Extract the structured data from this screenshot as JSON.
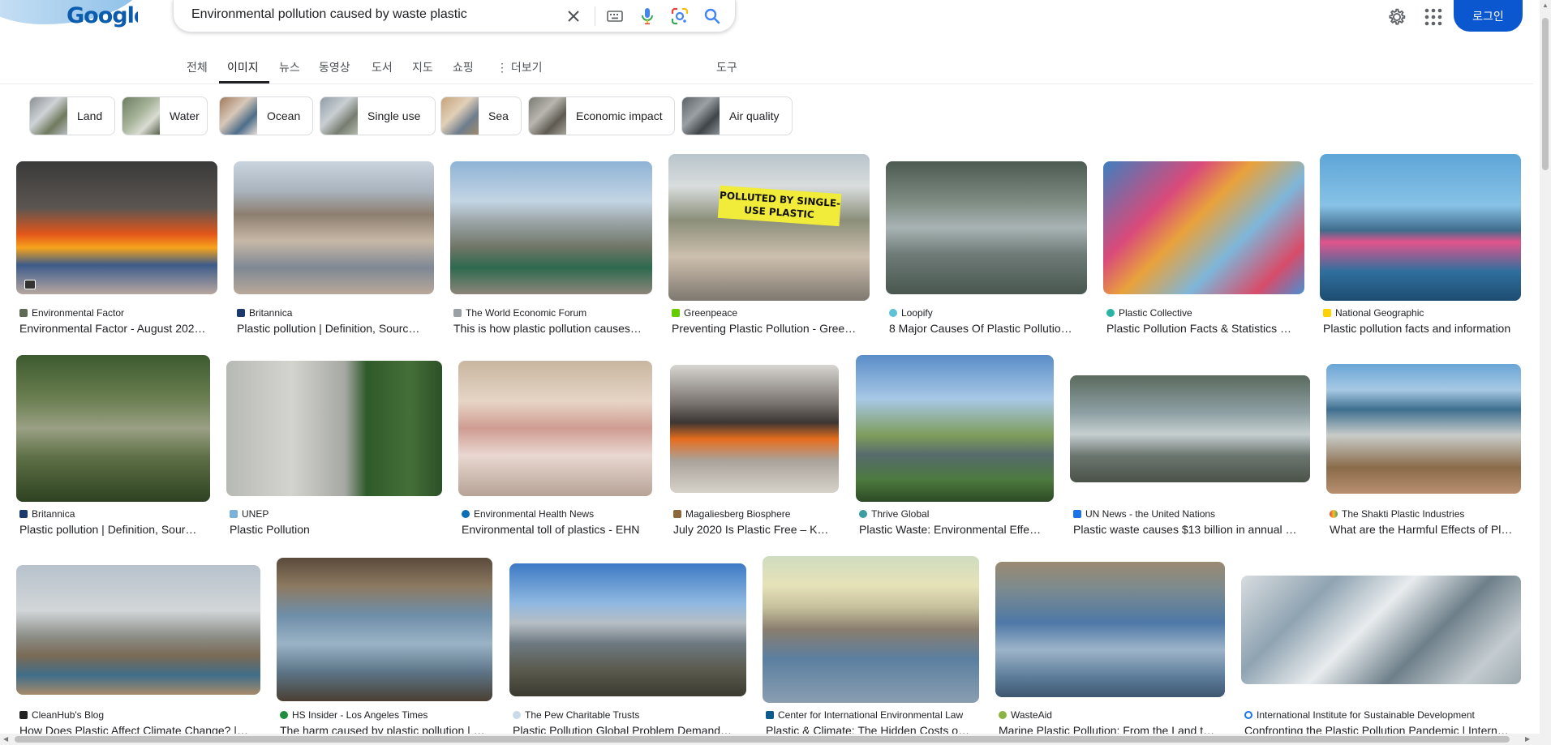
{
  "header": {
    "logo_text": "Google",
    "search_query": "Environmental pollution caused by waste plastic",
    "login_label": "로그인",
    "icons": [
      "clear-icon",
      "keyboard-icon",
      "mic-icon",
      "lens-icon",
      "search-icon",
      "gear-icon",
      "apps-icon"
    ]
  },
  "tabs": [
    {
      "label": "전체"
    },
    {
      "label": "이미지",
      "active": true
    },
    {
      "label": "뉴스"
    },
    {
      "label": "동영상"
    },
    {
      "label": "도서"
    },
    {
      "label": "지도"
    },
    {
      "label": "쇼핑"
    },
    {
      "label": "⋮ 더보기"
    }
  ],
  "tools_label": "도구",
  "chips": [
    "Land",
    "Water",
    "Ocean",
    "Single use",
    "Sea",
    "Economic impact",
    "Air quality"
  ],
  "results": [
    {
      "source": "Environmental Factor",
      "title": "Environmental Factor - August 202…"
    },
    {
      "source": "Britannica",
      "title": "Plastic pollution | Definition, Sourc…"
    },
    {
      "source": "The World Economic Forum",
      "title": "This is how plastic pollution causes…"
    },
    {
      "source": "Greenpeace",
      "title": "Preventing Plastic Pollution - Gree…",
      "banner": "POLLUTED BY SINGLE-USE PLASTIC"
    },
    {
      "source": "Loopify",
      "title": "8 Major Causes Of Plastic Pollutio…"
    },
    {
      "source": "Plastic Collective",
      "title": "Plastic Pollution Facts & Statistics …"
    },
    {
      "source": "National Geographic",
      "title": "Plastic pollution facts and information"
    },
    {
      "source": "Britannica",
      "title": "Plastic pollution | Definition, Sour…"
    },
    {
      "source": "UNEP",
      "title": "Plastic Pollution"
    },
    {
      "source": "Environmental Health News",
      "title": "Environmental toll of plastics - EHN"
    },
    {
      "source": "Magaliesberg Biosphere",
      "title": "July 2020 Is Plastic Free – K…"
    },
    {
      "source": "Thrive Global",
      "title": "Plastic Waste: Environmental Effe…"
    },
    {
      "source": "UN News - the United Nations",
      "title": "Plastic waste causes $13 billion in annual …"
    },
    {
      "source": "The Shakti Plastic Industries",
      "title": "What are the Harmful Effects of Pl…"
    },
    {
      "source": "CleanHub's Blog",
      "title": "How Does Plastic Affect Climate Change? |…"
    },
    {
      "source": "HS Insider - Los Angeles Times",
      "title": "The harm caused by plastic pollution | …"
    },
    {
      "source": "The Pew Charitable Trusts",
      "title": "Plastic Pollution Global Problem Demand…"
    },
    {
      "source": "Center for International Environmental Law",
      "title": "Plastic & Climate: The Hidden Costs o…"
    },
    {
      "source": "WasteAid",
      "title": "Marine Plastic Pollution: From the Land t…"
    },
    {
      "source": "International Institute for Sustainable Development",
      "title": "Confronting the Plastic Pollution Pandemic | Intern…"
    }
  ]
}
